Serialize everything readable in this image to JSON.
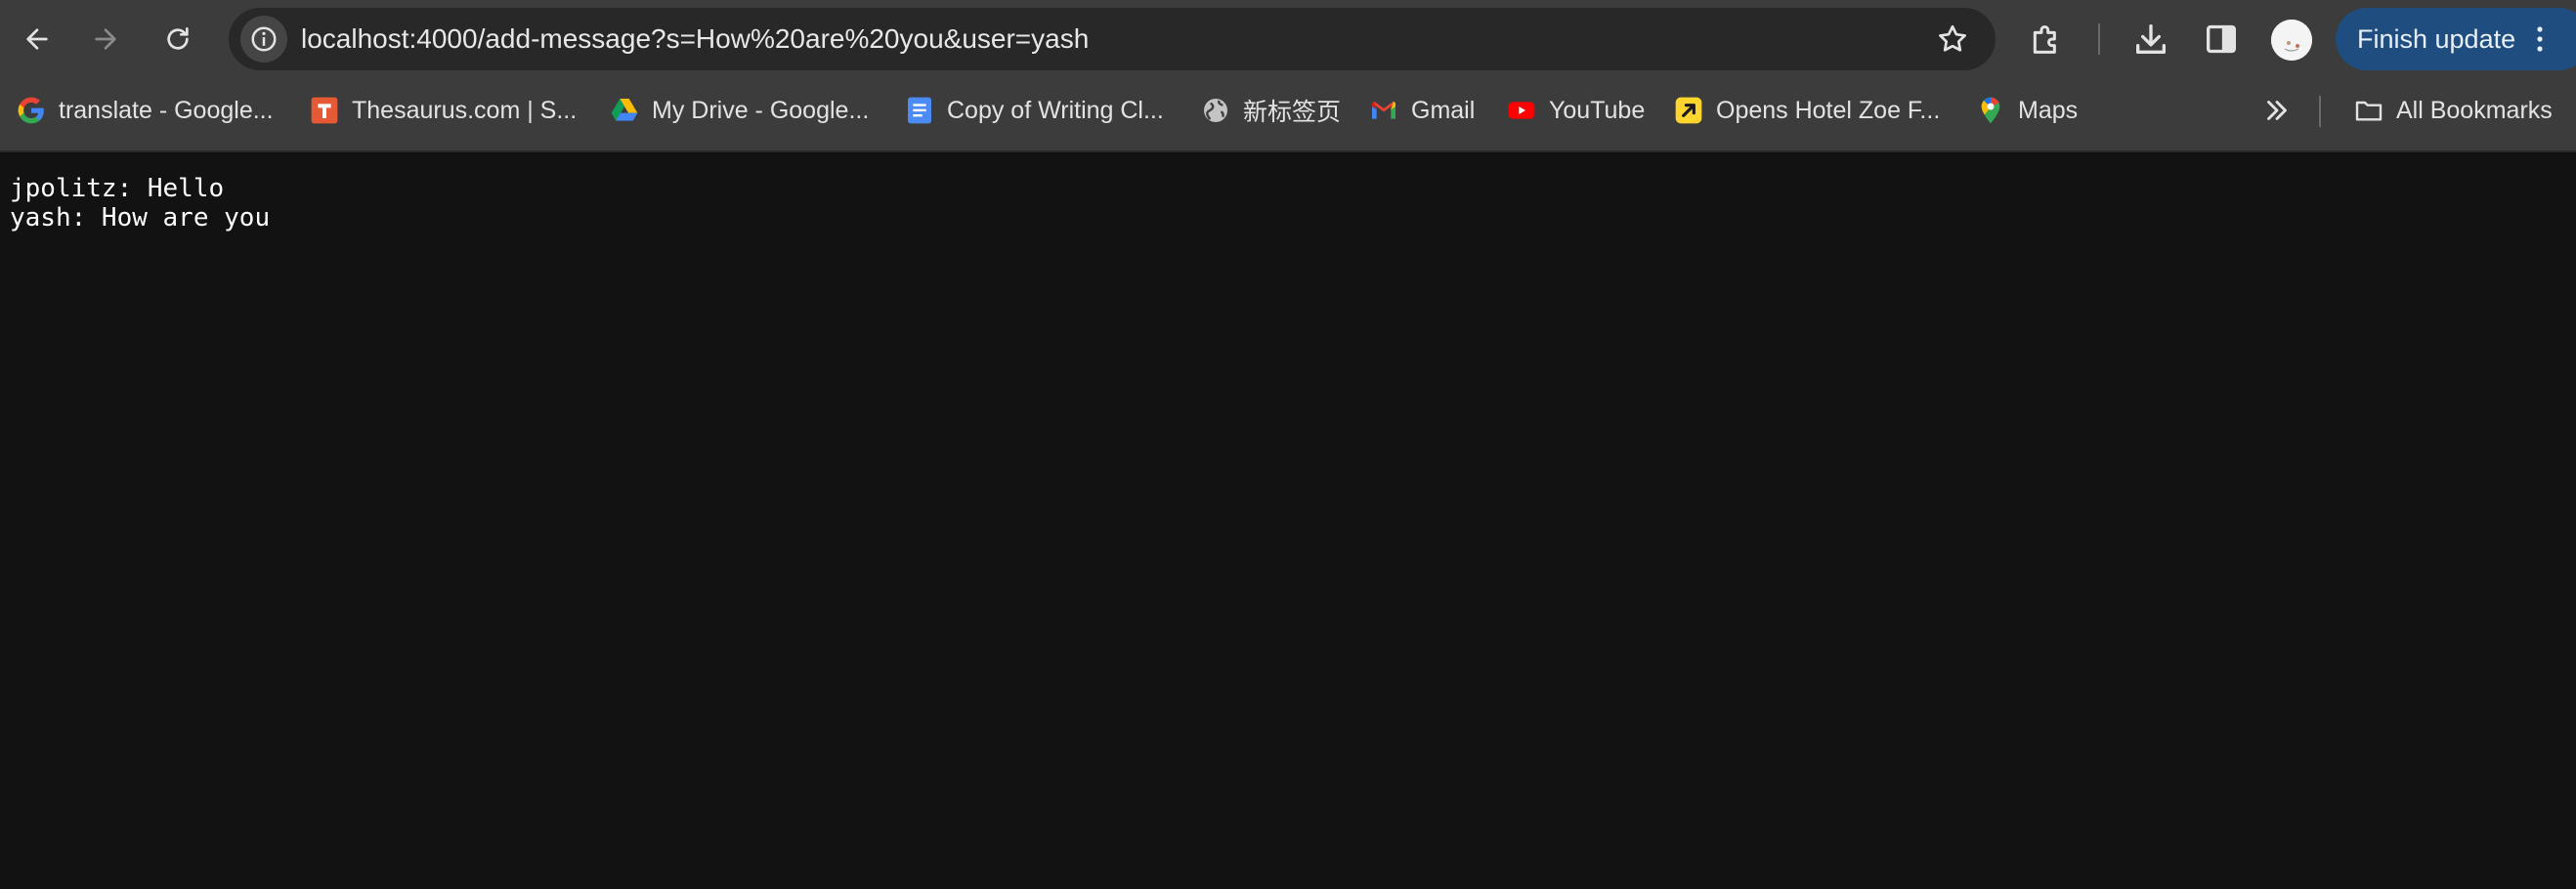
{
  "browser": {
    "address_bar": {
      "url": "localhost:4000/add-message?s=How%20are%20you&user=yash"
    },
    "update_button_label": "Finish update",
    "bookmarks": [
      {
        "label": "translate - Google...",
        "icon": "google-icon"
      },
      {
        "label": "Thesaurus.com | S...",
        "icon": "thesaurus-icon"
      },
      {
        "label": "My Drive - Google...",
        "icon": "google-drive-icon"
      },
      {
        "label": "Copy of Writing Cl...",
        "icon": "google-docs-icon"
      },
      {
        "label": "新标签页",
        "icon": "globe-icon"
      },
      {
        "label": "Gmail",
        "icon": "gmail-icon"
      },
      {
        "label": "YouTube",
        "icon": "youtube-icon"
      },
      {
        "label": "Opens Hotel Zoe F...",
        "icon": "external-link-icon"
      },
      {
        "label": "Maps",
        "icon": "maps-pin-icon"
      }
    ],
    "all_bookmarks_label": "All Bookmarks",
    "colors": {
      "toolbar": "#3c3c3c",
      "omnibox": "#282828",
      "update_button": "#1f4d80",
      "page_background": "#121212"
    }
  },
  "page": {
    "messages": [
      "jpolitz: Hello",
      "yash: How are you"
    ]
  }
}
